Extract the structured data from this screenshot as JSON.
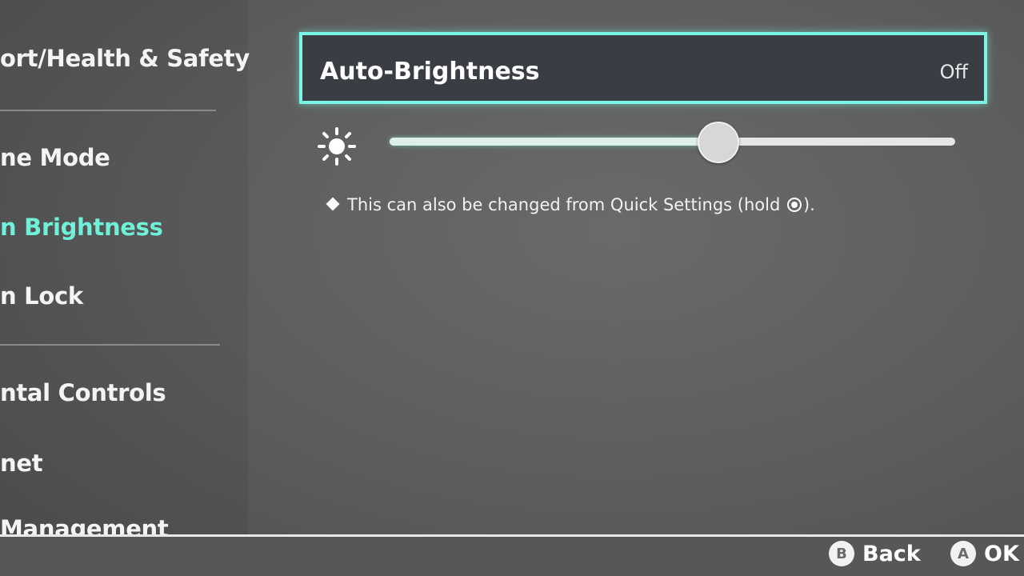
{
  "sidebar": {
    "items": [
      {
        "label": "ort/Health & Safety"
      },
      {
        "label": "ne Mode"
      },
      {
        "label": "n Brightness"
      },
      {
        "label": "n Lock"
      },
      {
        "label": "ntal Controls"
      },
      {
        "label": "net"
      },
      {
        "label": " Management"
      }
    ],
    "active_index": 2
  },
  "main": {
    "auto_brightness": {
      "label": "Auto-Brightness",
      "value": "Off"
    },
    "brightness_slider": {
      "icon": "sun-icon",
      "level": 0.58
    },
    "note": {
      "text_before": "This can also be changed from Quick Settings (hold ",
      "icon": "home-button-icon",
      "text_after": ")."
    }
  },
  "footer": {
    "back": {
      "glyph": "B",
      "label": "Back"
    },
    "ok": {
      "glyph": "A",
      "label": "OK"
    }
  },
  "colors": {
    "accent": "#6ff0d9",
    "focus_border": "#7af5e3",
    "background": "#5a5a5a"
  }
}
